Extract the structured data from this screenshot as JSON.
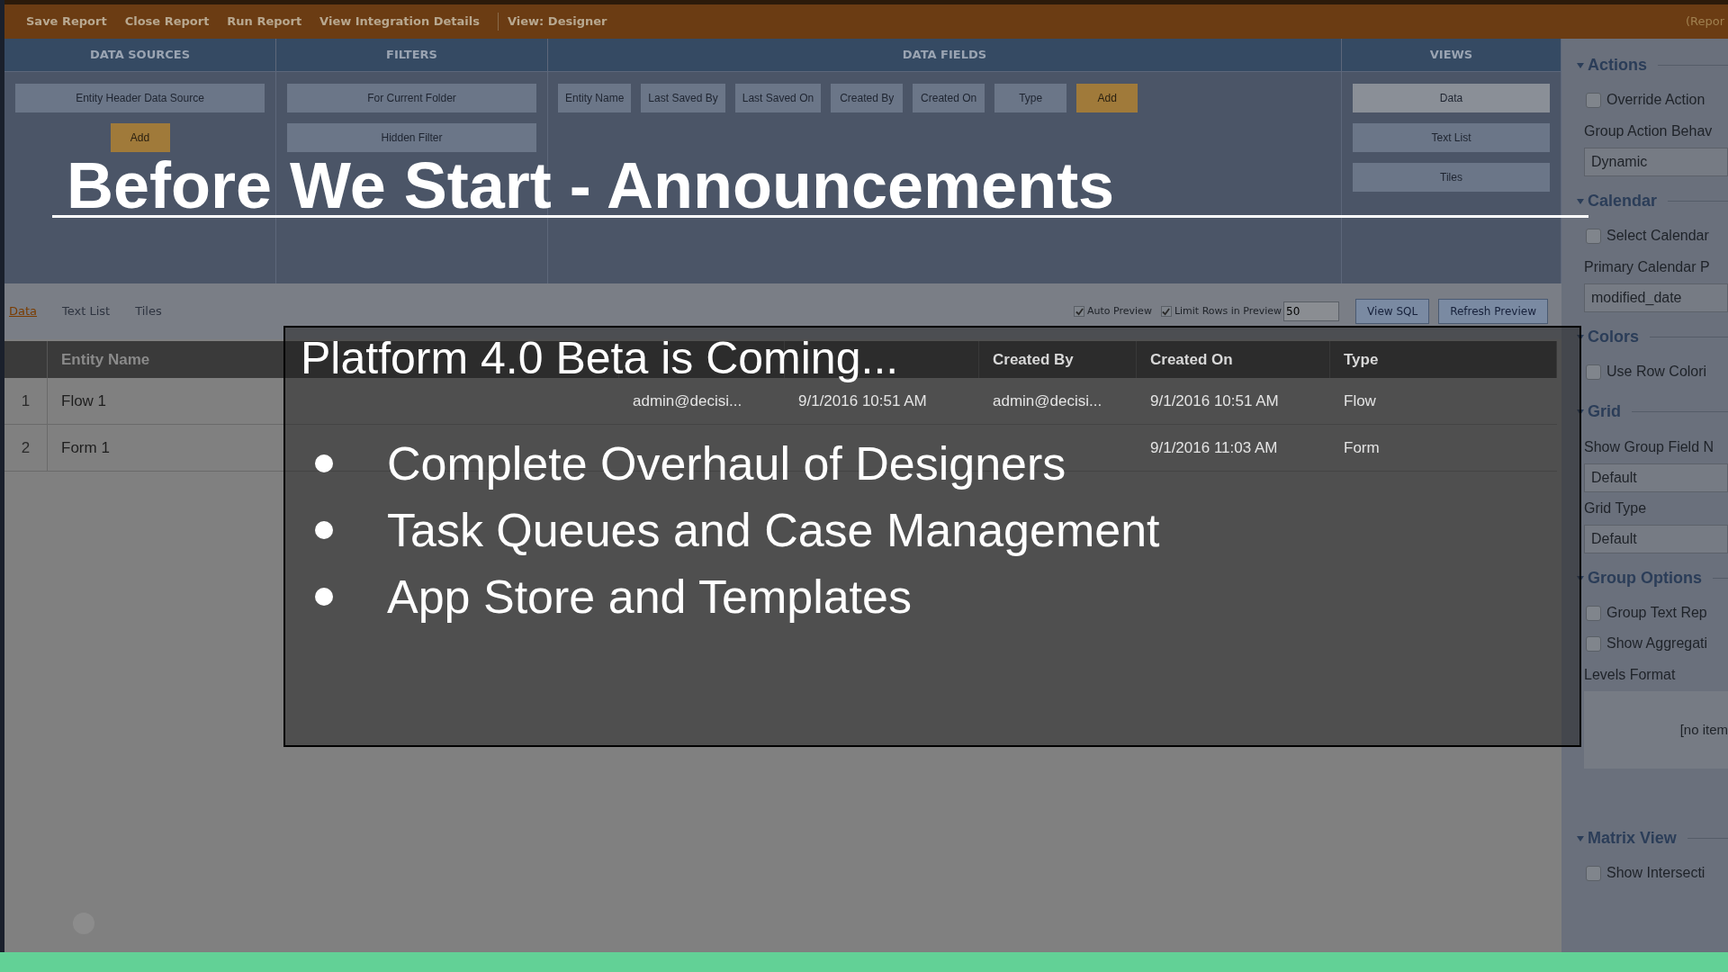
{
  "toolbar": {
    "items": [
      "Save Report",
      "Close Report",
      "Run Report",
      "View Integration Details"
    ],
    "view_label": "View: Designer",
    "right_text": "(Repor"
  },
  "designer": {
    "panels": [
      {
        "title": "DATA SOURCES",
        "kind": "stack",
        "items": [
          {
            "label": "Entity Header Data Source",
            "selected": false
          }
        ],
        "add": "Add"
      },
      {
        "title": "FILTERS",
        "kind": "stack",
        "items": [
          {
            "label": "For Current Folder",
            "selected": false
          },
          {
            "label": "Hidden Filter",
            "selected": false
          }
        ]
      },
      {
        "title": "DATA FIELDS",
        "kind": "inline",
        "items": [
          {
            "label": "Entity Name",
            "selected": false
          },
          {
            "label": "Last Saved By",
            "selected": false
          },
          {
            "label": "Last Saved On",
            "selected": false
          },
          {
            "label": "Created By",
            "selected": false
          },
          {
            "label": "Created On",
            "selected": false
          },
          {
            "label": "Type",
            "selected": false
          }
        ],
        "add": "Add"
      },
      {
        "title": "VIEWS",
        "kind": "stack",
        "items": [
          {
            "label": "Data",
            "selected": true
          },
          {
            "label": "Text List",
            "selected": false
          },
          {
            "label": "Tiles",
            "selected": false
          }
        ]
      }
    ]
  },
  "preview_tabs": [
    {
      "label": "Data",
      "selected": true
    },
    {
      "label": "Text List",
      "selected": false
    },
    {
      "label": "Tiles",
      "selected": false
    }
  ],
  "preview_options": {
    "checkboxes": [
      {
        "label": "Auto Preview",
        "checked": true
      },
      {
        "label": "Limit Rows in Preview",
        "checked": true
      }
    ],
    "row_limit": "50",
    "buttons": [
      "View SQL",
      "Refresh Preview"
    ]
  },
  "table": {
    "columns": [
      "Entity Name"
    ],
    "right_columns": [
      "Created By",
      "Created On",
      "Type"
    ],
    "rows": [
      {
        "number": "1",
        "cells": [
          "Flow 1",
          "admin@decisi...",
          "9/1/2016 10:51 AM",
          "admin@decisi...",
          "9/1/2016 10:51 AM",
          "Flow"
        ]
      },
      {
        "number": "2",
        "cells": [
          "Form 1"
        ],
        "right_cells": [
          "9/1/2016 11:03 AM",
          "Form"
        ]
      }
    ]
  },
  "properties_panel": {
    "sections": [
      {
        "title": "Actions",
        "items": [
          {
            "kind": "checkbox",
            "label": "Override Action",
            "checked": false
          },
          {
            "kind": "label",
            "label": "Group Action Behav"
          },
          {
            "kind": "select",
            "value": "Dynamic"
          }
        ]
      },
      {
        "title": "Calendar",
        "items": [
          {
            "kind": "checkbox",
            "label": "Select Calendar",
            "checked": false
          },
          {
            "kind": "label",
            "label": "Primary Calendar P"
          },
          {
            "kind": "select",
            "value": "modified_date"
          }
        ]
      },
      {
        "title": "Colors",
        "items": [
          {
            "kind": "checkbox",
            "label": "Use Row Colori",
            "checked": false
          }
        ]
      },
      {
        "title": "Grid",
        "items": [
          {
            "kind": "label",
            "label": "Show Group Field N"
          },
          {
            "kind": "select",
            "value": "Default"
          },
          {
            "kind": "label",
            "label": "Grid Type"
          },
          {
            "kind": "select",
            "value": "Default"
          }
        ]
      },
      {
        "title": "Group Options",
        "items": [
          {
            "kind": "checkbox",
            "label": "Group Text Rep",
            "checked": false
          },
          {
            "kind": "checkbox",
            "label": "Show Aggregati",
            "checked": false
          },
          {
            "kind": "label",
            "label": "Levels Format"
          },
          {
            "kind": "listbox",
            "value": "[no item"
          }
        ]
      },
      {
        "title": "Matrix View",
        "items": [
          {
            "kind": "checkbox",
            "label": "Show Intersecti",
            "checked": false
          }
        ]
      }
    ]
  },
  "slide": {
    "title": "Before We Start - Announcements",
    "heading": "Platform 4.0 Beta is Coming...",
    "bullets": [
      "Complete Overhaul of Designers",
      "Task Queues and Case Management",
      "App Store and Templates"
    ]
  }
}
